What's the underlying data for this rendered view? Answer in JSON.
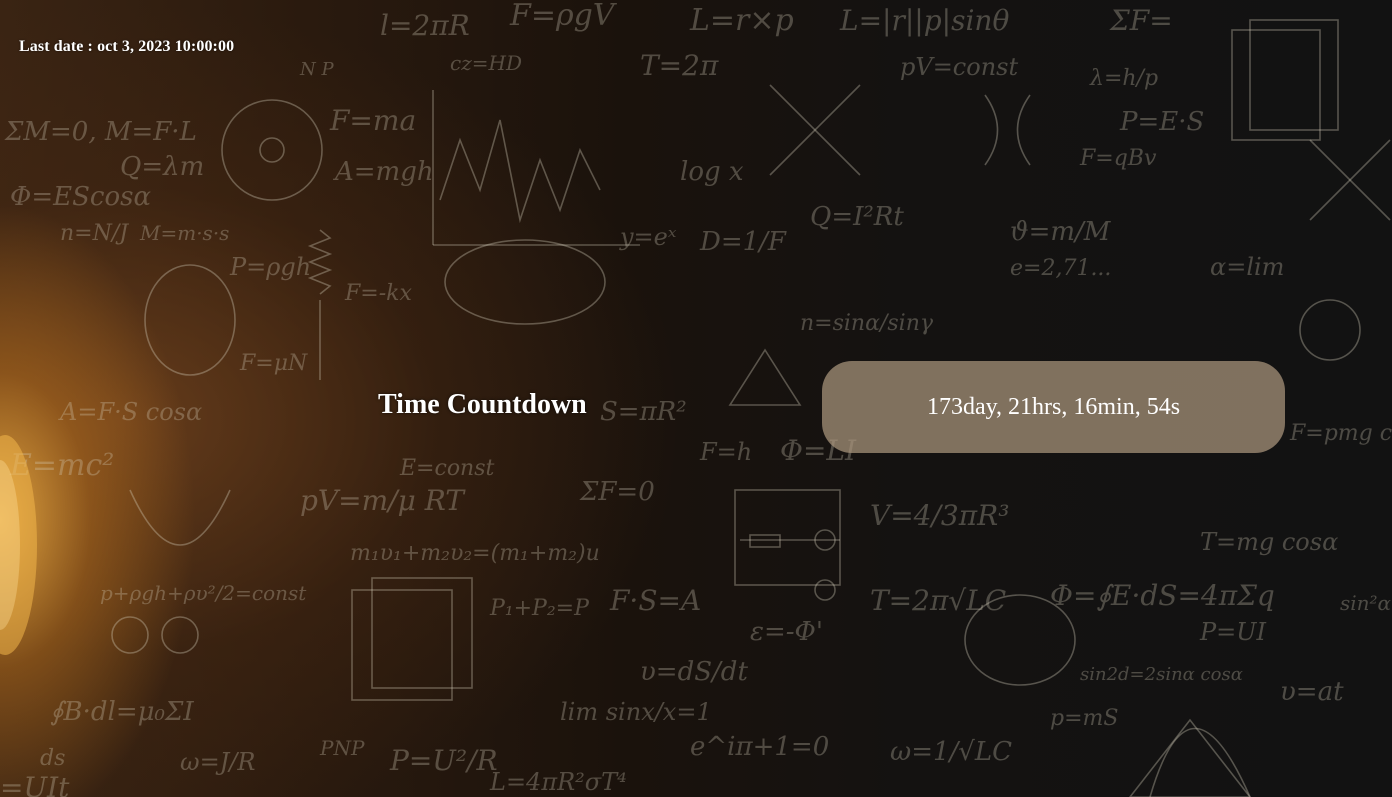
{
  "header": {
    "last_date": "Last date : oct 3, 2023 10:00:00"
  },
  "countdown": {
    "title": "Time Countdown",
    "value": "173day, 21hrs, 16min, 54s"
  },
  "background": {
    "description_icon": "physics-formulas-blackboard-icon",
    "colors": {
      "wood_warm": "#3a2413",
      "glow": "#f5b446",
      "dark": "#121212",
      "chalk": "#d9d2c3",
      "box": "#aa967d"
    }
  }
}
